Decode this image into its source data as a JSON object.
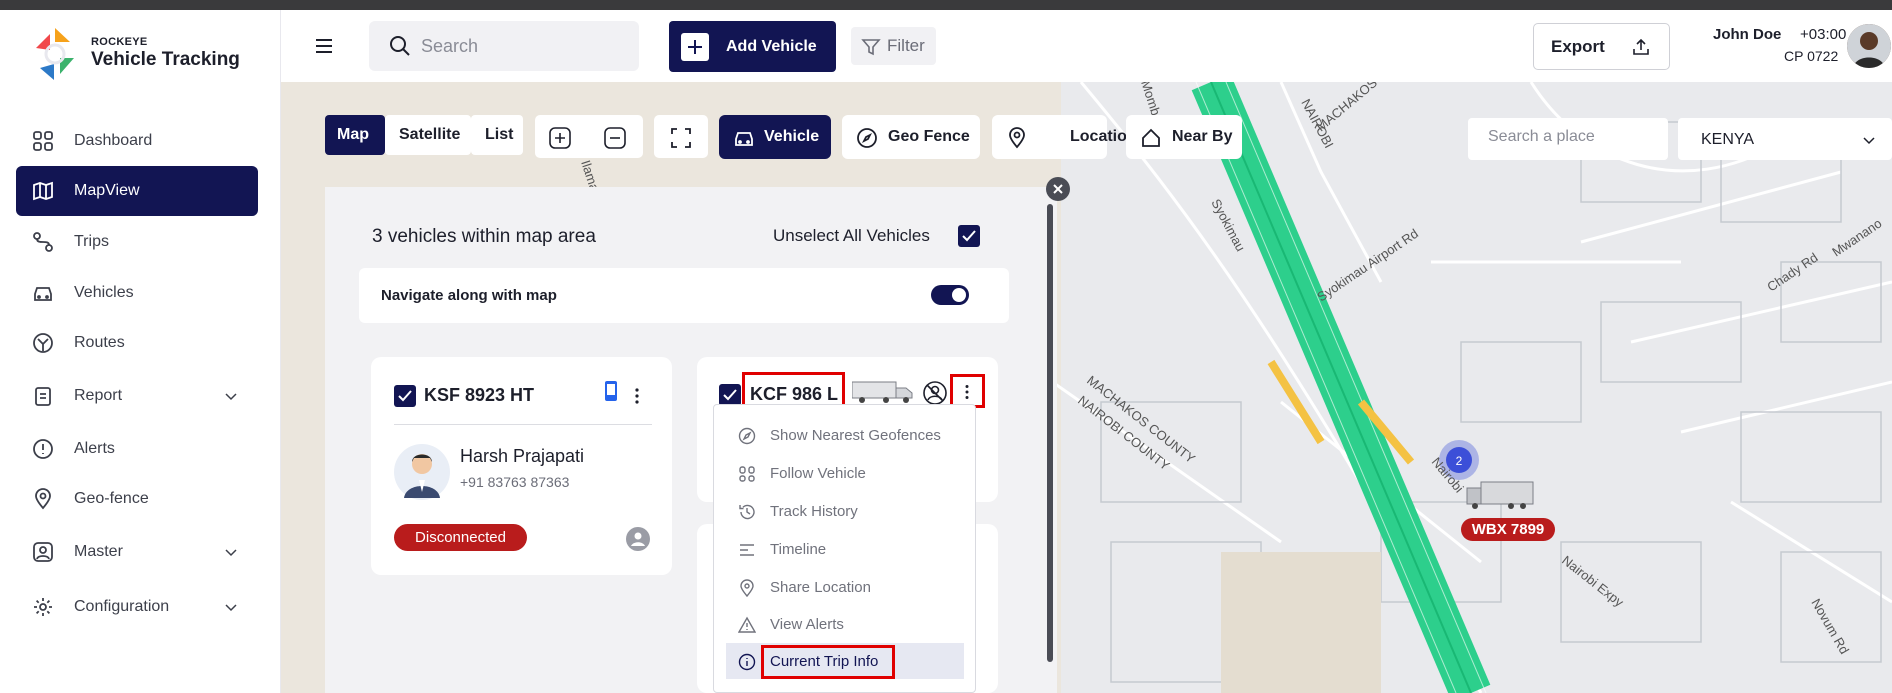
{
  "app": {
    "brand_small": "ROCKEYE",
    "brand_title": "Vehicle Tracking"
  },
  "sidebar": {
    "items": [
      {
        "label": "Dashboard",
        "icon": "grid-icon"
      },
      {
        "label": "MapView",
        "icon": "map-icon",
        "active": true
      },
      {
        "label": "Trips",
        "icon": "route-pin-icon"
      },
      {
        "label": "Vehicles",
        "icon": "car-icon"
      },
      {
        "label": "Routes",
        "icon": "fork-icon"
      },
      {
        "label": "Report",
        "icon": "clipboard-icon",
        "expandable": true
      },
      {
        "label": "Alerts",
        "icon": "alert-circle-icon"
      },
      {
        "label": "Geo-fence",
        "icon": "location-pin-icon"
      },
      {
        "label": "Master",
        "icon": "user-square-icon",
        "expandable": true
      },
      {
        "label": "Configuration",
        "icon": "gear-icon",
        "expandable": true
      }
    ]
  },
  "topbar": {
    "search_placeholder": "Search",
    "add_vehicle_label": "Add Vehicle",
    "filter_label": "Filter",
    "export_label": "Export",
    "user_name": "John Doe",
    "user_timezone": "+03:00",
    "user_code": "CP 0722"
  },
  "map_controls": {
    "view_tabs": [
      "Map",
      "Satellite",
      "List"
    ],
    "selected_view": "Map",
    "layer_buttons": [
      "Vehicle",
      "Geo Fence",
      "Location",
      "Near By"
    ],
    "active_layer": "Vehicle",
    "place_search_placeholder": "Search a place",
    "country": "KENYA"
  },
  "map_labels": {
    "cluster_count": "2",
    "vehicle_tag": "WBX 7899",
    "roads": [
      "Syokimau",
      "Syokimau Airport Rd",
      "Nairobi Expy",
      "Nairobi",
      "Chady Rd",
      "Mwanano",
      "Novum Rd",
      "NAIROBI",
      "MACHAKOS",
      "MACHAKOS COUNTY",
      "NAIROBI COUNTY",
      "Mombasa",
      "Ilama"
    ]
  },
  "panel": {
    "title": "3 vehicles within map area",
    "unselect_label": "Unselect All Vehicles",
    "navigate_label": "Navigate along with map",
    "navigate_on": true,
    "vehicles": [
      {
        "plate": "KSF 8923 HT",
        "driver": "Harsh Prajapati",
        "phone": "+91 83763 87363",
        "status": "Disconnected",
        "status_color": "#b91c1c"
      },
      {
        "plate": "KCF 986 L"
      }
    ],
    "context_menu": [
      {
        "label": "Show Nearest Geofences",
        "icon": "compass-icon"
      },
      {
        "label": "Follow Vehicle",
        "icon": "follow-icon"
      },
      {
        "label": "Track History",
        "icon": "history-icon"
      },
      {
        "label": "Timeline",
        "icon": "timeline-icon"
      },
      {
        "label": "Share Location",
        "icon": "location-pin-icon"
      },
      {
        "label": "View Alerts",
        "icon": "warning-icon"
      },
      {
        "label": "Current Trip Info",
        "icon": "info-icon",
        "highlighted": true
      }
    ]
  },
  "colors": {
    "primary": "#121553",
    "danger": "#b91c1c",
    "route": "#2dcf8c",
    "annotation": "#e00000"
  }
}
